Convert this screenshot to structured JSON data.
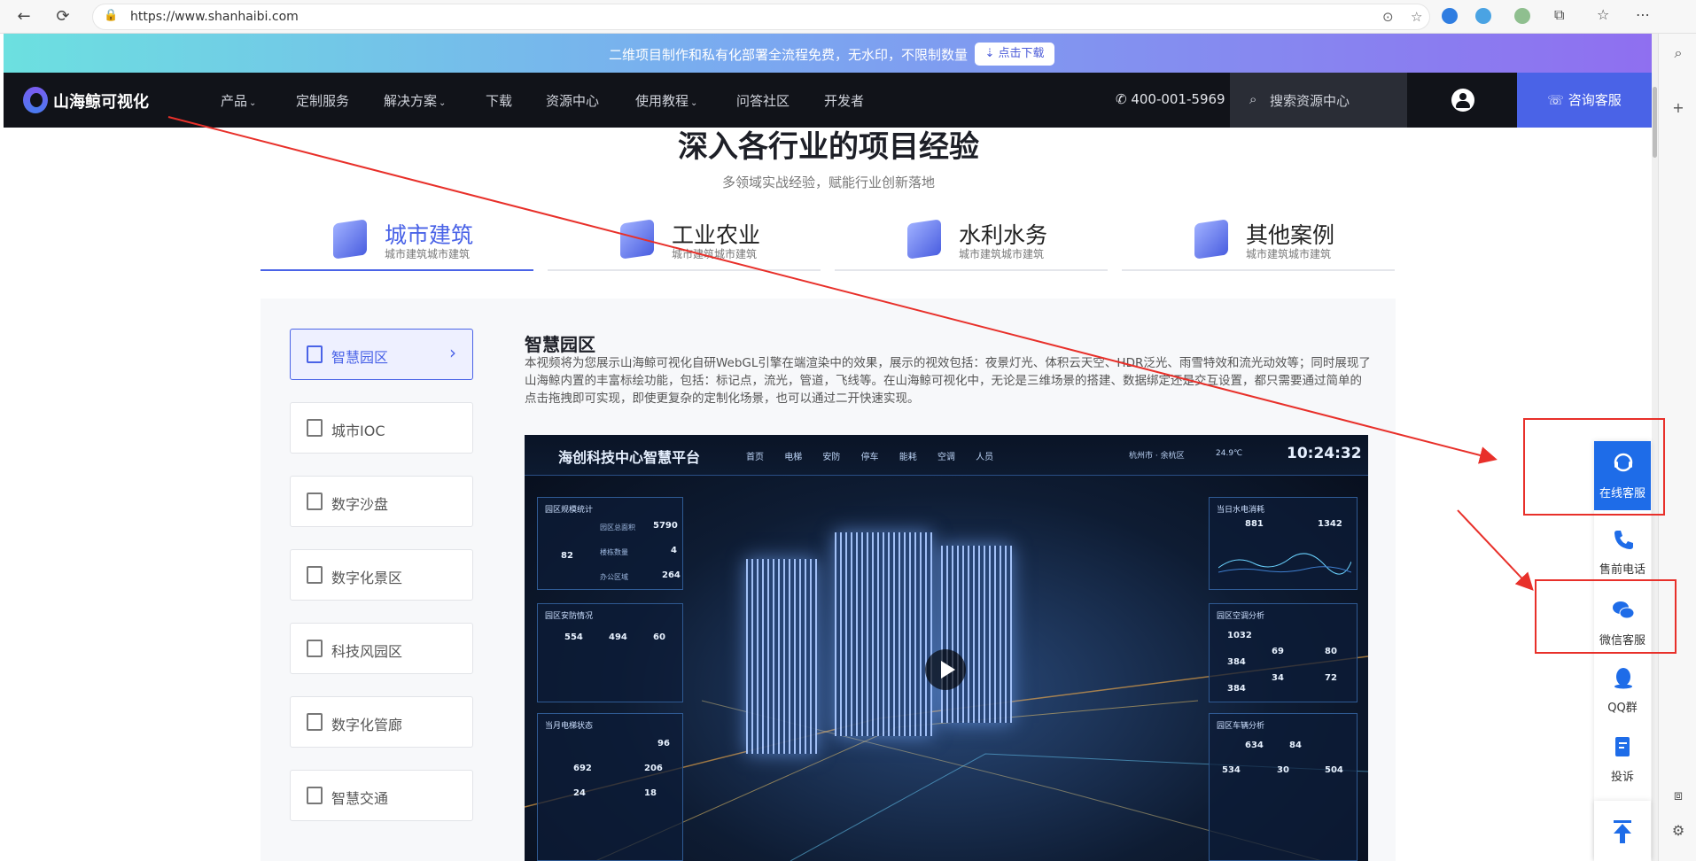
{
  "browser": {
    "url": "https://www.shanhaibi.com"
  },
  "promo": {
    "text": "二维项目制作和私有化部署全流程免费，无水印，不限制数量",
    "button": "⇣ 点击下载"
  },
  "nav": {
    "logo_text": "山海鲸可视化",
    "items": [
      "产品",
      "定制服务",
      "解决方案",
      "下载",
      "资源中心",
      "使用教程",
      "问答社区",
      "开发者"
    ],
    "phone": "400-001-5969",
    "search_placeholder": "搜索资源中心",
    "consult": "咨询客服"
  },
  "section": {
    "title": "深入各行业的项目经验",
    "subtitle": "多领域实战经验，赋能行业创新落地"
  },
  "tabs": [
    {
      "title": "城市建筑",
      "sub": "城市建筑城市建筑"
    },
    {
      "title": "工业农业",
      "sub": "城市建筑城市建筑"
    },
    {
      "title": "水利水务",
      "sub": "城市建筑城市建筑"
    },
    {
      "title": "其他案例",
      "sub": "城市建筑城市建筑"
    }
  ],
  "sidelist": [
    "智慧园区",
    "城市IOC",
    "数字沙盘",
    "数字化景区",
    "科技风园区",
    "数字化管廊",
    "智慧交通"
  ],
  "content": {
    "title": "智慧园区",
    "desc": "本视频将为您展示山海鲸可视化自研WebGL引擎在端渲染中的效果，展示的视效包括：夜景灯光、体积云天空、HDR泛光、雨雪特效和流光动效等；同时展现了山海鲸内置的丰富标绘功能，包括：标记点，流光，管道，飞线等。在山海鲸可视化中，无论是三维场景的搭建、数据绑定还是交互设置，都只需要通过简单的点击拖拽即可实现，即使更复杂的定制化场景，也可以通过二开快速实现。"
  },
  "video": {
    "title": "海创科技中心智慧平台",
    "tabs": [
      "首页",
      "电梯",
      "安防",
      "停车",
      "能耗",
      "空调",
      "人员"
    ],
    "location": "杭州市 · 余杭区",
    "temp": "24.9℃",
    "time": "10:24:32",
    "panels": {
      "scale": {
        "title": "园区规模统计",
        "items": [
          {
            "label": "园区总面积",
            "value": "5790"
          },
          {
            "label": "楼栋数量",
            "value": "4"
          },
          {
            "label": "办公区域",
            "value": "264"
          }
        ],
        "ring": "82"
      },
      "security": {
        "title": "园区安防情况",
        "values": [
          "554",
          "494",
          "60"
        ]
      },
      "elevator": {
        "title": "当月电梯状态",
        "values": [
          "96",
          "692",
          "206",
          "24",
          "18"
        ]
      },
      "power": {
        "title": "当日水电消耗",
        "values": [
          "881",
          "1342"
        ]
      },
      "ac": {
        "title": "园区空调分析",
        "values": [
          "1032",
          "69",
          "80",
          "384",
          "34",
          "72",
          "384"
        ]
      },
      "parking": {
        "title": "园区车辆分析",
        "values": [
          "634",
          "84",
          "534",
          "30",
          "504"
        ]
      }
    }
  },
  "float_bar": {
    "items": [
      "在线客服",
      "售前电话",
      "微信客服",
      "QQ群",
      "投诉"
    ]
  }
}
